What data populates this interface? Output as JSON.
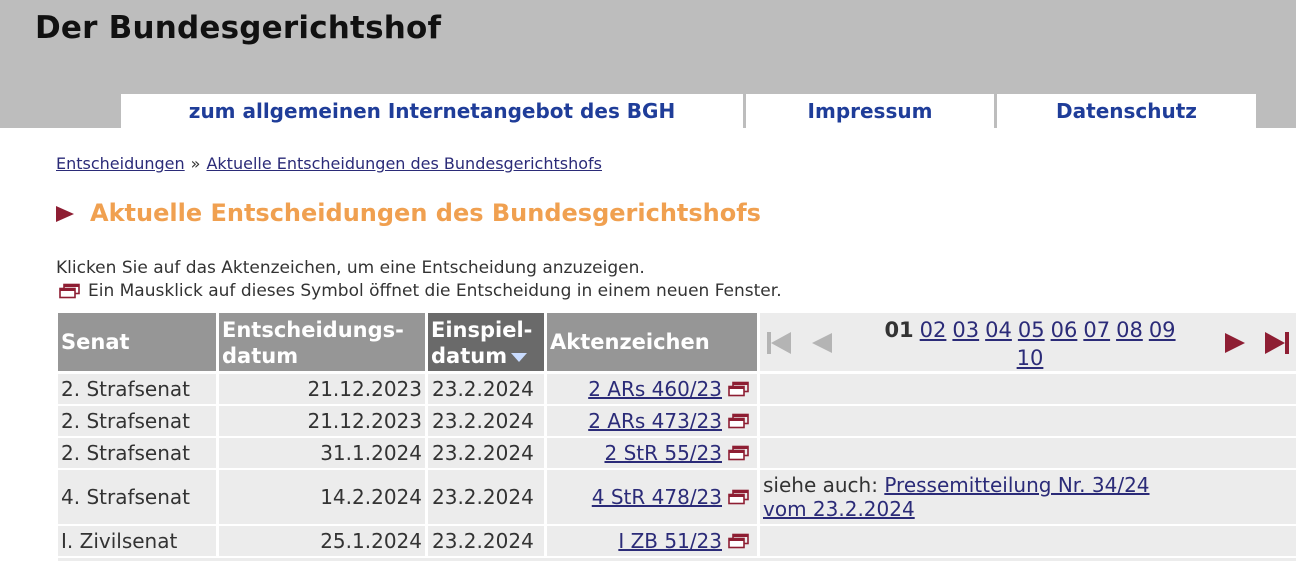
{
  "site_title": "Der Bundesgerichtshof",
  "nav": {
    "main": "zum allgemeinen Internetangebot des BGH",
    "impressum": "Impressum",
    "datenschutz": "Datenschutz"
  },
  "breadcrumb": {
    "item1": "Entscheidungen",
    "separator": "»",
    "item2": "Aktuelle Entscheidungen des Bundesgerichtshofs"
  },
  "page_heading": "Aktuelle Entscheidungen des Bundesgerichtshofs",
  "instructions": {
    "line1": "Klicken Sie auf das Aktenzeichen, um eine Entscheidung anzuzeigen.",
    "line2": "Ein Mausklick auf dieses Symbol öffnet die Entscheidung in einem neuen Fenster."
  },
  "table": {
    "headers": {
      "senat": "Senat",
      "entsch_1": "Entscheidungs-",
      "entsch_2": "datum",
      "einspiel_1": "Einspiel-",
      "einspiel_2": "datum",
      "akten": "Aktenzeichen"
    },
    "rows": [
      {
        "senat": "2. Strafsenat",
        "entsch": "21.12.2023",
        "einspiel": "23.2.2024",
        "az": "2 ARs 460/23"
      },
      {
        "senat": "2. Strafsenat",
        "entsch": "21.12.2023",
        "einspiel": "23.2.2024",
        "az": "2 ARs 473/23"
      },
      {
        "senat": "2. Strafsenat",
        "entsch": "31.1.2024",
        "einspiel": "23.2.2024",
        "az": "2 StR 55/23"
      },
      {
        "senat": "4. Strafsenat",
        "entsch": "14.2.2024",
        "einspiel": "23.2.2024",
        "az": "4 StR 478/23",
        "extra_prefix": "siehe auch:",
        "extra_link": "Pressemitteilung Nr. 34/24 vom 23.2.2024"
      },
      {
        "senat": "I. Zivilsenat",
        "entsch": "25.1.2024",
        "einspiel": "23.2.2024",
        "az": "I ZB 51/23"
      }
    ]
  },
  "pager": {
    "current": "01",
    "pages": [
      "02",
      "03",
      "04",
      "05",
      "06",
      "07",
      "08",
      "09",
      "10"
    ]
  },
  "colors": {
    "header_bg": "#bdbdbd",
    "nav_text": "#1f3d99",
    "heading": "#f0a050",
    "marker": "#8e1e33",
    "table_header": "#969696",
    "table_header_sorted": "#6a6a6a",
    "cell_bg": "#ececec",
    "link": "#2b2b78"
  }
}
